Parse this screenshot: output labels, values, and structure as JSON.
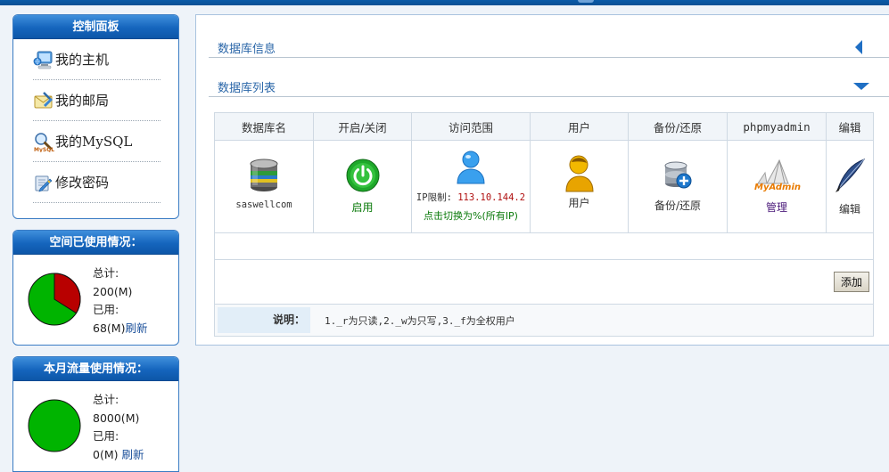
{
  "sidebar": {
    "control_panel": {
      "title": "控制面板",
      "items": [
        {
          "label": "我的主机",
          "icon": "computer-icon"
        },
        {
          "label": "我的邮局",
          "icon": "mail-icon"
        },
        {
          "label": "我的MySQL",
          "icon": "mysql-icon"
        },
        {
          "label": "修改密码",
          "icon": "edit-password-icon"
        }
      ]
    },
    "space_usage": {
      "title": "空间已使用情况：",
      "total_label": "总计:",
      "total_value": "200(M)",
      "used_label": "已用:",
      "used_value": "68(M)",
      "refresh": "刷新",
      "used_fraction": 0.34
    },
    "traffic_usage": {
      "title": "本月流量使用情况：",
      "total_label": "总计:",
      "total_value": "8000(M)",
      "used_label": "已用:",
      "used_value": "0(M)",
      "refresh": "刷新",
      "used_fraction": 0
    }
  },
  "main": {
    "info_section": "数据库信息",
    "list_section": "数据库列表",
    "table": {
      "headers": [
        "数据库名",
        "开启/关闭",
        "访问范围",
        "用户",
        "备份/还原",
        "phpmyadmin",
        "编辑"
      ],
      "row": {
        "db_name": "saswellcom",
        "status": "启用",
        "ip_label": "IP限制:",
        "ip_value": "113.10.144.2",
        "ip_switch": "点击切换为%(所有IP)",
        "user": "用户",
        "backup": "备份/还原",
        "manage": "管理",
        "edit": "编辑"
      },
      "add_button": "添加",
      "note_label": "说明：",
      "note_text": "1._r为只读,2._w为只写,3._f为全权用户"
    }
  },
  "colors": {
    "header_blue": "#1565bd",
    "pie_used": "#b80000",
    "pie_free": "#00b400",
    "link": "#1a4f9a"
  }
}
